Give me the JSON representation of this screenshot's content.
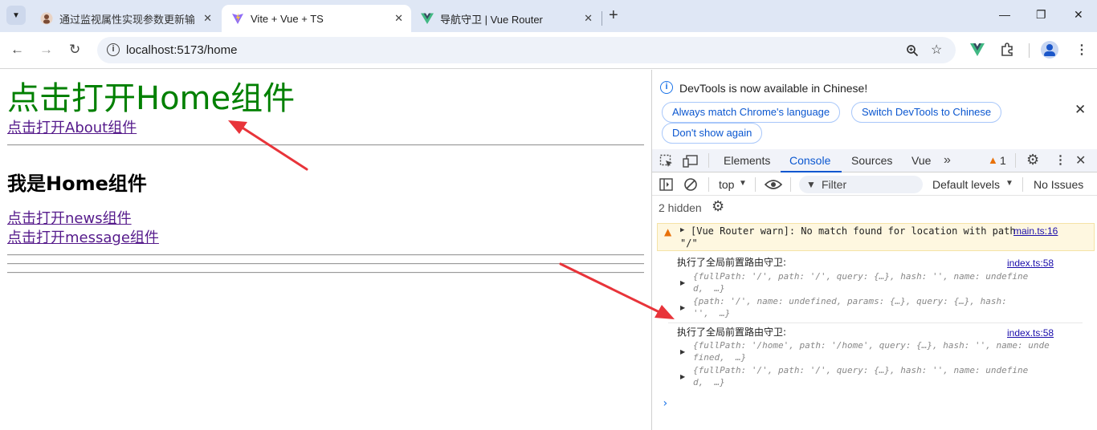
{
  "browser": {
    "tabs": [
      {
        "title": "通过监视属性实现参数更新输出",
        "close": "✕"
      },
      {
        "title": "Vite + Vue + TS",
        "close": "✕"
      },
      {
        "title": "导航守卫 | Vue Router",
        "close": "✕"
      }
    ],
    "new_tab": "+",
    "window": {
      "minimize": "—",
      "restore": "❐",
      "close": "✕"
    },
    "url": "localhost:5173/home"
  },
  "page": {
    "title": "点击打开Home组件",
    "about_link": "点击打开About组件",
    "heading": "我是Home组件",
    "news_link": "点击打开news组件",
    "message_link": "点击打开message组件"
  },
  "devtools": {
    "notice": "DevTools is now available in Chinese!",
    "btn_match": "Always match Chrome's language",
    "btn_switch": "Switch DevTools to Chinese",
    "btn_dont_show": "Don't show again",
    "tabs": [
      "Elements",
      "Console",
      "Sources",
      "Vue"
    ],
    "warning_count": "1",
    "context": "top",
    "filter_placeholder": "Filter",
    "levels": "Default levels",
    "issues": "No Issues",
    "hidden": "2 hidden",
    "console": {
      "warn_text": "[Vue Router warn]: No match found for location with path",
      "warn_path": "\"/\"",
      "warn_src": "main.ts:16",
      "log1": "执行了全局前置路由守卫:",
      "log1_src": "index.ts:58",
      "log1_obj1_a": "{fullPath: '/', path: '/', query: {…}, hash: '', name: undefine",
      "log1_obj1_b": "d,  …}",
      "log1_obj2_a": "{path: '/', name: undefined, params: {…}, query: {…}, hash:",
      "log1_obj2_b": "'',  …}",
      "log2": "执行了全局前置路由守卫:",
      "log2_src": "index.ts:58",
      "log2_obj1_a": "{fullPath: '/home', path: '/home', query: {…}, hash: '', name: unde",
      "log2_obj1_b": "fined,  …}",
      "log2_obj2_a": "{fullPath: '/', path: '/', query: {…}, hash: '', name: undefine",
      "log2_obj2_b": "d,  …}",
      "prompt": "›"
    }
  },
  "colors": {
    "title_green": "#008000",
    "link_visited": "#551a8b",
    "accent_blue": "#0b57d0",
    "annotation_red": "#e8343a"
  }
}
